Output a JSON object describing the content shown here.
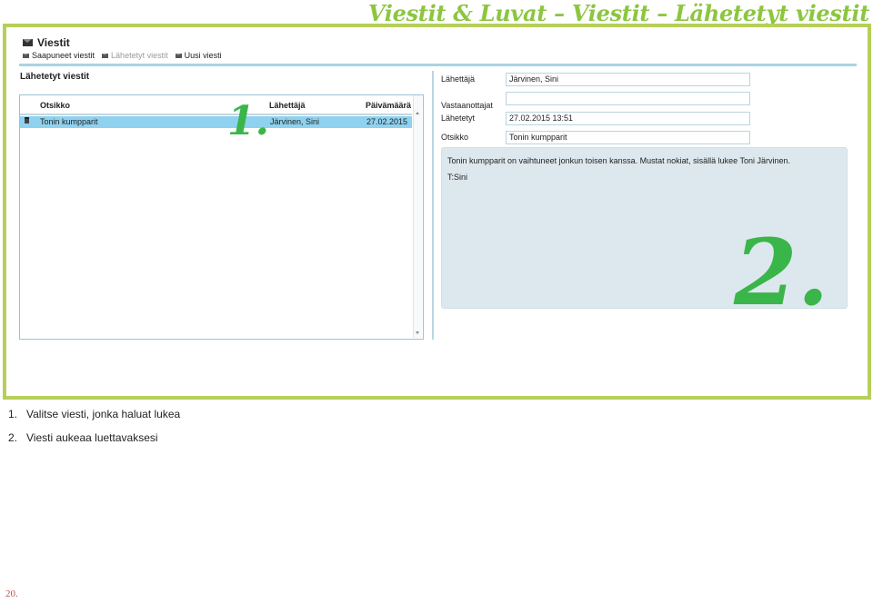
{
  "header": {
    "title": "Viestit & Luvat – Viestit – Lähetetyt viestit"
  },
  "app": {
    "title": "Viestit",
    "icon": "envelope-icon",
    "nav": [
      {
        "label": "Saapuneet viestit",
        "icon": "envelope-icon"
      },
      {
        "label": "Lähetetyt viestit",
        "icon": "envelope-icon",
        "active": true
      },
      {
        "label": "Uusi viesti",
        "icon": "envelope-icon"
      }
    ]
  },
  "list": {
    "section_title": "Lähetetyt viestit",
    "columns": [
      "Otsikko",
      "Lähettäjä",
      "Päivämäärä"
    ],
    "rows": [
      {
        "icon": "trash-icon",
        "subject": "Tonin kumpparit",
        "sender": "Järvinen, Sini",
        "date": "27.02.2015",
        "selected": true
      }
    ]
  },
  "detail": {
    "fields": [
      {
        "label": "Lähettäjä",
        "value": "Järvinen, Sini"
      },
      {
        "label": "Vastaanottajat",
        "value": ""
      },
      {
        "label": "Lähetetyt",
        "value": "27.02.2015 13:51"
      },
      {
        "label": "Otsikko",
        "value": "Tonin kumpparit"
      }
    ],
    "message_line1": "Tonin kumpparit on vaihtuneet jonkun toisen kanssa. Mustat nokiat, sisällä lukee Toni Järvinen.",
    "message_line2": "T:Sini"
  },
  "annotations": {
    "marker1": "1.",
    "marker2": "2."
  },
  "instructions": [
    {
      "num": "1.",
      "text": "Valitse viesti, jonka haluat lukea"
    },
    {
      "num": "2.",
      "text": "Viesti aukeaa luettavaksesi"
    }
  ],
  "page_number": "20.",
  "colors": {
    "header_green": "#8cc63f",
    "frame_green": "#b5cf5a",
    "marker_green": "#3ab54a",
    "selected_row": "#8fd2ef",
    "message_bg": "#dde8ee"
  }
}
